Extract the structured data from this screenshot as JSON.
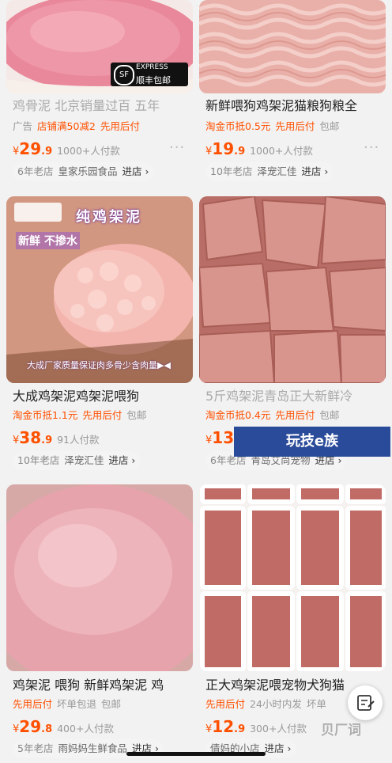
{
  "products": [
    {
      "title": "鸡骨泥 北京销量过百 五年",
      "tags": [
        "广告",
        "店铺满50减2",
        "先用后付"
      ],
      "price_int": "29",
      "price_dec": ".9",
      "currency": "¥",
      "sold": "1000+人付款",
      "shop_age": "6年老店",
      "shop_name": "皇家乐园食品",
      "shop_go": "进店 ›"
    },
    {
      "title": "新鲜喂狗鸡架泥猫粮狗粮全",
      "tags": [
        "淘金币抵0.5元",
        "先用后付",
        "包邮"
      ],
      "price_int": "19",
      "price_dec": ".9",
      "currency": "¥",
      "sold": "1000+人付款",
      "shop_age": "10年老店",
      "shop_name": "泽宠汇佳",
      "shop_go": "进店 ›"
    },
    {
      "title": "大成鸡架泥鸡架泥喂狗",
      "tags": [
        "淘金币抵1.1元",
        "先用后付",
        "包邮"
      ],
      "price_int": "38",
      "price_dec": ".9",
      "currency": "¥",
      "sold": "91人付款",
      "shop_age": "10年老店",
      "shop_name": "泽宠汇佳",
      "shop_go": "进店 ›"
    },
    {
      "title": "5斤鸡架泥青岛正大新鲜冷",
      "tags": [
        "淘金币抵0.4元",
        "先用后付",
        "包邮"
      ],
      "price_int": "13",
      "price_dec": "",
      "currency": "¥",
      "sold": "",
      "shop_age": "6年老店",
      "shop_name": "青岛艾尚宠物",
      "shop_go": "进店 ›"
    },
    {
      "title": "鸡架泥 喂狗 新鲜鸡架泥 鸡",
      "tags": [
        "先用后付",
        "坏单包退",
        "包邮"
      ],
      "price_int": "29",
      "price_dec": ".8",
      "currency": "¥",
      "sold": "400+人付款",
      "shop_age": "5年老店",
      "shop_name": "雨妈妈生鲜食品",
      "shop_go": "进店 ›"
    },
    {
      "title": "正大鸡架泥喂宠物犬狗猫",
      "tags": [
        "先用后付",
        "24小时内发",
        "坏单"
      ],
      "price_int": "12",
      "price_dec": ".9",
      "currency": "¥",
      "sold": "300+人付款",
      "shop_age": "",
      "shop_name": "倩妈的小店",
      "shop_go": "进店 ›"
    }
  ],
  "image_text": {
    "express_top": "EXPRESS",
    "express_bottom": "顺丰包邮",
    "p3_banner": "纯鸡架泥",
    "p3_sub": "新鲜 不掺水",
    "p3_bottom": "大成厂家质量保证肉多骨少含肉量▶◀"
  },
  "overlay_logo": "玩技e族",
  "more_icon": "···",
  "watermark": "贝厂词",
  "colors": {
    "accent": "#ff5000",
    "meat": "#e58a93",
    "bg": "#f2f2f2"
  }
}
